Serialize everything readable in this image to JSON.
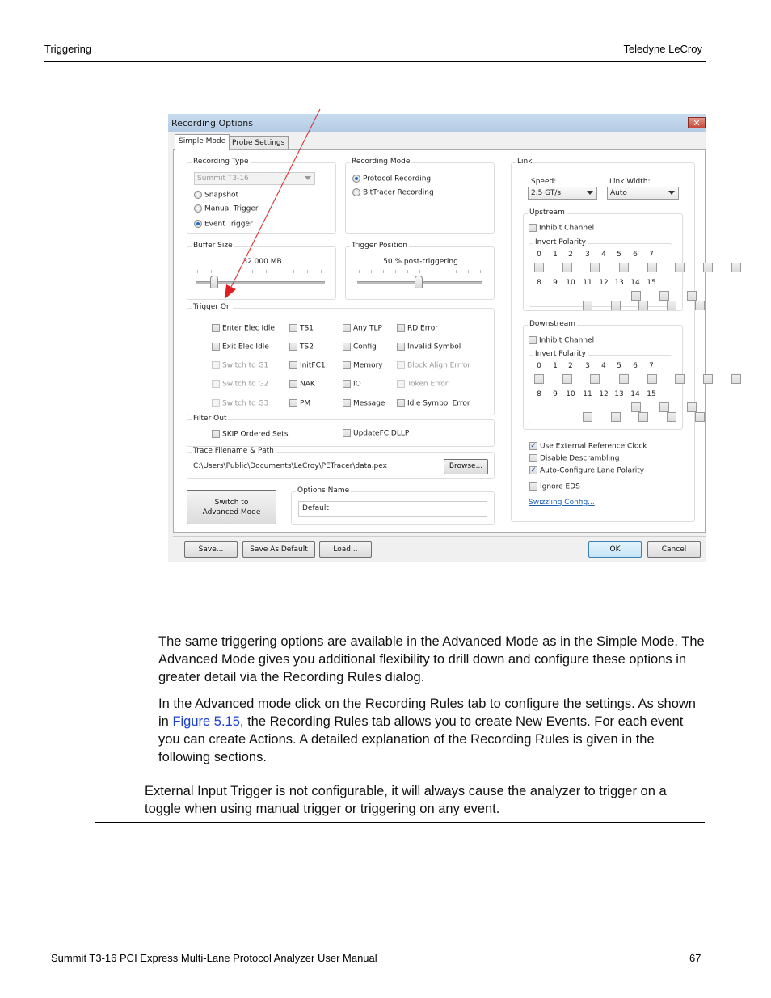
{
  "page_header": {
    "left": "Triggering",
    "right": "Teledyne LeCroy"
  },
  "dialog": {
    "title": "Recording Options",
    "close_icon": "close-icon",
    "tabs": [
      {
        "label": "Simple Mode",
        "active": true
      },
      {
        "label": "Probe Settings",
        "active": false
      }
    ],
    "recording_type": {
      "title": "Recording Type",
      "analyzer_select": "Summit T3-16",
      "options": [
        {
          "label": "Snapshot",
          "selected": false
        },
        {
          "label": "Manual Trigger",
          "selected": false
        },
        {
          "label": "Event Trigger",
          "selected": true
        }
      ]
    },
    "recording_mode": {
      "title": "Recording Mode",
      "options": [
        {
          "label": "Protocol Recording",
          "selected": true
        },
        {
          "label": "BitTracer Recording",
          "selected": false
        }
      ]
    },
    "buffer_size": {
      "title": "Buffer Size",
      "value": "32.000 MB",
      "slider_fraction": 0.1
    },
    "trigger_position": {
      "title": "Trigger Position",
      "value": "50 % post-triggering",
      "slider_fraction": 0.5
    },
    "trigger_on": {
      "title": "Trigger On",
      "columns": [
        [
          {
            "label": "Enter Elec Idle",
            "checked": false,
            "enabled": true
          },
          {
            "label": "Exit Elec Idle",
            "checked": false,
            "enabled": true
          },
          {
            "label": "Switch to G1",
            "checked": false,
            "enabled": false
          },
          {
            "label": "Switch to G2",
            "checked": false,
            "enabled": false
          },
          {
            "label": "Switch to G3",
            "checked": false,
            "enabled": false
          }
        ],
        [
          {
            "label": "TS1",
            "checked": false,
            "enabled": true
          },
          {
            "label": "TS2",
            "checked": false,
            "enabled": true
          },
          {
            "label": "InitFC1",
            "checked": false,
            "enabled": true
          },
          {
            "label": "NAK",
            "checked": false,
            "enabled": true
          },
          {
            "label": "PM",
            "checked": false,
            "enabled": true
          }
        ],
        [
          {
            "label": "Any TLP",
            "checked": false,
            "enabled": true
          },
          {
            "label": "Config",
            "checked": false,
            "enabled": true
          },
          {
            "label": "Memory",
            "checked": false,
            "enabled": true
          },
          {
            "label": "IO",
            "checked": false,
            "enabled": true
          },
          {
            "label": "Message",
            "checked": false,
            "enabled": true
          }
        ],
        [
          {
            "label": "RD Error",
            "checked": false,
            "enabled": true
          },
          {
            "label": "Invalid Symbol",
            "checked": false,
            "enabled": true
          },
          {
            "label": "Block Align Errror",
            "checked": false,
            "enabled": false
          },
          {
            "label": "Token Error",
            "checked": false,
            "enabled": false
          },
          {
            "label": "Idle Symbol Error",
            "checked": false,
            "enabled": true
          }
        ]
      ]
    },
    "filter_out": {
      "title": "Filter Out",
      "items": [
        {
          "label": "SKIP Ordered Sets",
          "checked": false
        },
        {
          "label": "UpdateFC DLLP",
          "checked": false
        }
      ]
    },
    "trace_file": {
      "title": "Trace Filename & Path",
      "path": "C:\\Users\\Public\\Documents\\LeCroy\\PETracer\\data.pex",
      "browse_label": "Browse..."
    },
    "switch_mode_label_line1": "Switch to",
    "switch_mode_label_line2": "Advanced Mode",
    "options_name": {
      "title": "Options Name",
      "value": "Default"
    },
    "link": {
      "title": "Link",
      "speed_label": "Speed:",
      "speed_value": "2.5 GT/s",
      "width_label": "Link Width:",
      "width_value": "Auto",
      "upstream": {
        "title": "Upstream",
        "inhibit_label": "Inhibit Channel",
        "inhibit_checked": false,
        "polarity_title": "Invert Polarity"
      },
      "downstream": {
        "title": "Downstream",
        "inhibit_label": "Inhibit Channel",
        "inhibit_checked": false,
        "polarity_title": "Invert Polarity"
      },
      "lanes_row1": [
        "0",
        "1",
        "2",
        "3",
        "4",
        "5",
        "6",
        "7"
      ],
      "lanes_row2": [
        "8",
        "9",
        "10",
        "11",
        "12",
        "13",
        "14",
        "15"
      ]
    },
    "misc_options": [
      {
        "label": "Use External Reference Clock",
        "checked": true
      },
      {
        "label": "Disable Descrambling",
        "checked": false
      },
      {
        "label": "Auto-Configure Lane Polarity",
        "checked": true
      },
      {
        "label": "Ignore EDS",
        "checked": false
      }
    ],
    "swizzling_link": "Swizzling Config...",
    "footer_buttons": {
      "save": "Save...",
      "save_default": "Save As Default",
      "load": "Load...",
      "ok": "OK",
      "cancel": "Cancel"
    }
  },
  "body": {
    "para1": "The same triggering options are available in the Advanced Mode as in the Simple Mode. The Advanced Mode gives you additional flexibility to drill down and configure these options in greater detail via the Recording Rules dialog.",
    "para2_before": "In the Advanced mode click on the Recording Rules tab to configure the settings. As shown in ",
    "para2_link": "Figure 5.15",
    "para2_after": ", the Recording Rules tab allows you to create New Events. For each event you can create Actions. A detailed explanation of the Recording Rules is given in the following sections.",
    "note": "External Input Trigger is not configurable, it will always cause the analyzer to trigger on a toggle when using manual trigger or triggering on any event."
  },
  "page_footer": {
    "title": "Summit T3-16 PCI Express Multi-Lane Protocol Analyzer User Manual",
    "page": "67"
  }
}
